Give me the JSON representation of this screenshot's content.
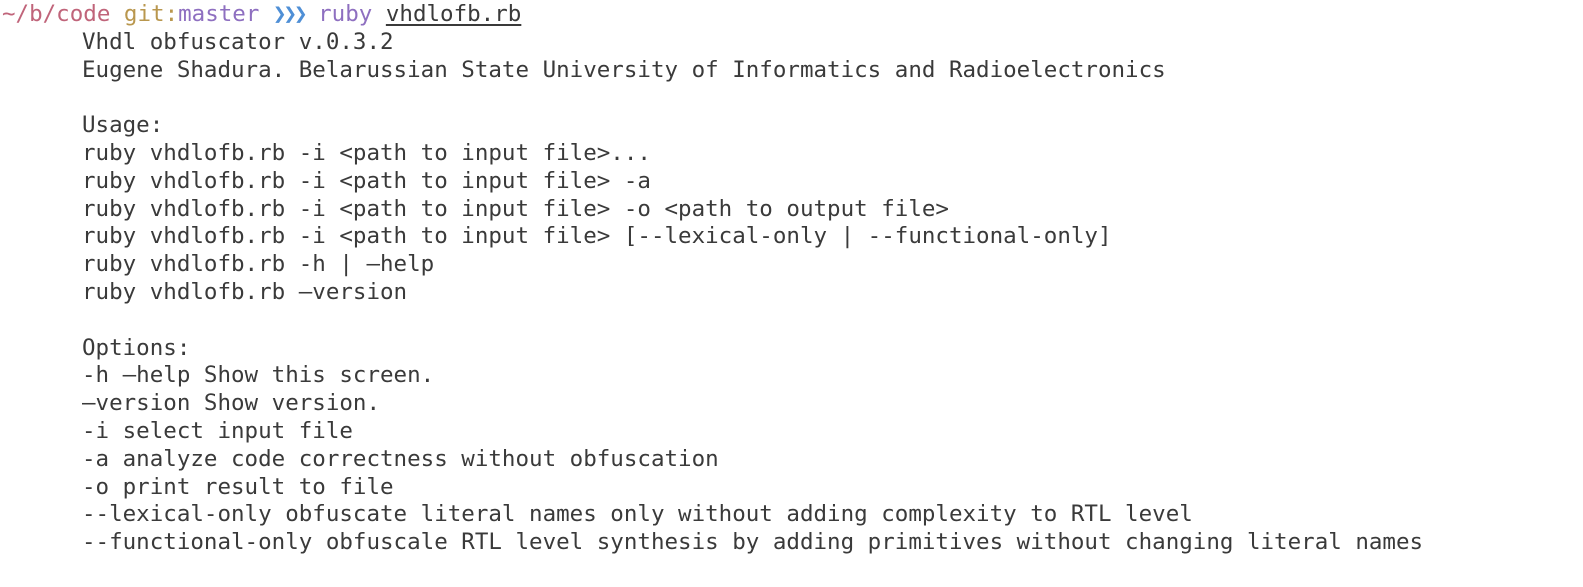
{
  "prompt": {
    "cwd": "~/b/code",
    "git_label": "git",
    "separator": ":",
    "branch": "master",
    "arrows": "❯❯❯",
    "command": "ruby",
    "argument": "vhdlofb.rb"
  },
  "output": {
    "header": [
      "Vhdl obfuscator v.0.3.2",
      "Eugene Shadura. Belarussian State University of Informatics and Radioelectronics"
    ],
    "usage_title": "Usage:",
    "usage": [
      "ruby vhdlofb.rb -i <path to input file>...",
      "ruby vhdlofb.rb -i <path to input file> -a",
      "ruby vhdlofb.rb -i <path to input file> -o <path to output file>",
      "ruby vhdlofb.rb -i <path to input file> [--lexical-only | --functional-only]",
      "ruby vhdlofb.rb -h | –help",
      "ruby vhdlofb.rb –version"
    ],
    "options_title": "Options:",
    "options": [
      "-h –help Show this screen.",
      "–version Show version.",
      "-i select input file",
      "-a analyze code correctness without obfuscation",
      "-o print result to file",
      "--lexical-only obfuscate literal names only without adding complexity to RTL level",
      "--functional-only obfuscale RTL level synthesis by adding primitives without changing literal names"
    ]
  }
}
